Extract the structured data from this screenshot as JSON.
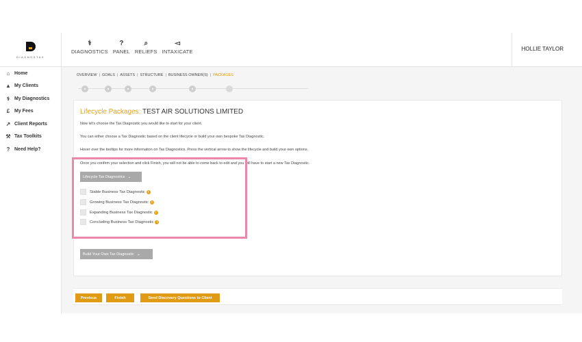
{
  "brand": {
    "logo_text": "DIAGNOSTAX",
    "accent": "#e3a21a"
  },
  "topnav": [
    {
      "label": "DIAGNOSTICS",
      "icon": "stethoscope-icon",
      "glyph": "⚕"
    },
    {
      "label": "PANEL",
      "icon": "question-icon",
      "glyph": "?"
    },
    {
      "label": "RELIEFS",
      "icon": "search-icon",
      "glyph": "⌕"
    },
    {
      "label": "INTAXICATE",
      "icon": "megaphone-icon",
      "glyph": "◅"
    }
  ],
  "user": {
    "name": "HOLLIE TAYLOR"
  },
  "sidebar": {
    "items": [
      {
        "label": "Home",
        "icon": "home-icon",
        "glyph": "⌂"
      },
      {
        "label": "My Clients",
        "icon": "user-icon",
        "glyph": "▲"
      },
      {
        "label": "My Diagnostics",
        "icon": "stethoscope-icon",
        "glyph": "⚕"
      },
      {
        "label": "My Fees",
        "icon": "pound-icon",
        "glyph": "£"
      },
      {
        "label": "Client Reports",
        "icon": "line-chart-icon",
        "glyph": "↗"
      },
      {
        "label": "Tax Toolkits",
        "icon": "wrench-icon",
        "glyph": "⚒"
      },
      {
        "label": "Need Help?",
        "icon": "question-icon",
        "glyph": "?"
      }
    ]
  },
  "breadcrumbs": [
    "OVERVIEW",
    "GOALS",
    "ASSETS",
    "STRUCTURE",
    "BUSINESS OWNER(S)",
    "PACKAGES"
  ],
  "stepper": {
    "steps": 6,
    "current": 6
  },
  "panel": {
    "title_accent": "Lifecycle Packages:",
    "title_company": "TEST AIR SOLUTIONS LIMITED",
    "paragraphs": [
      "Now let's choose the Tax Diagnostic you would like to start for your client.",
      "You can either choose a Tax Diagnostic based on the client lifecycle or build your own bespoke Tax Diagnostic.",
      "Hover over the tooltips for more information on Tax Diagnostics. Press the vertical arrow to show the lifecycle and build your own options.",
      "Once you confirm your selection and click Finish, you will not be able to come back to edit and you will have to start a new Tax Diagnostic."
    ],
    "lifecycle_dropdown": "Lifecycle Tax Diagnostics",
    "options": [
      {
        "label": "Stable Business Tax Diagnostic",
        "checked": false
      },
      {
        "label": "Growing Business Tax Diagnostic",
        "checked": false
      },
      {
        "label": "Expanding Business Tax Diagnostic",
        "checked": false
      },
      {
        "label": "Concluding Business Tax Diagnostic",
        "checked": false
      }
    ],
    "build_dropdown": "Build Your Own Tax Diagnostic"
  },
  "actions": {
    "previous": "Previous",
    "finish": "Finish",
    "send": "Send Discovery Questions to Client"
  },
  "colors": {
    "highlight": "#ec87ab",
    "button": "#e09a14",
    "dropdown": "#a9a9a9"
  }
}
